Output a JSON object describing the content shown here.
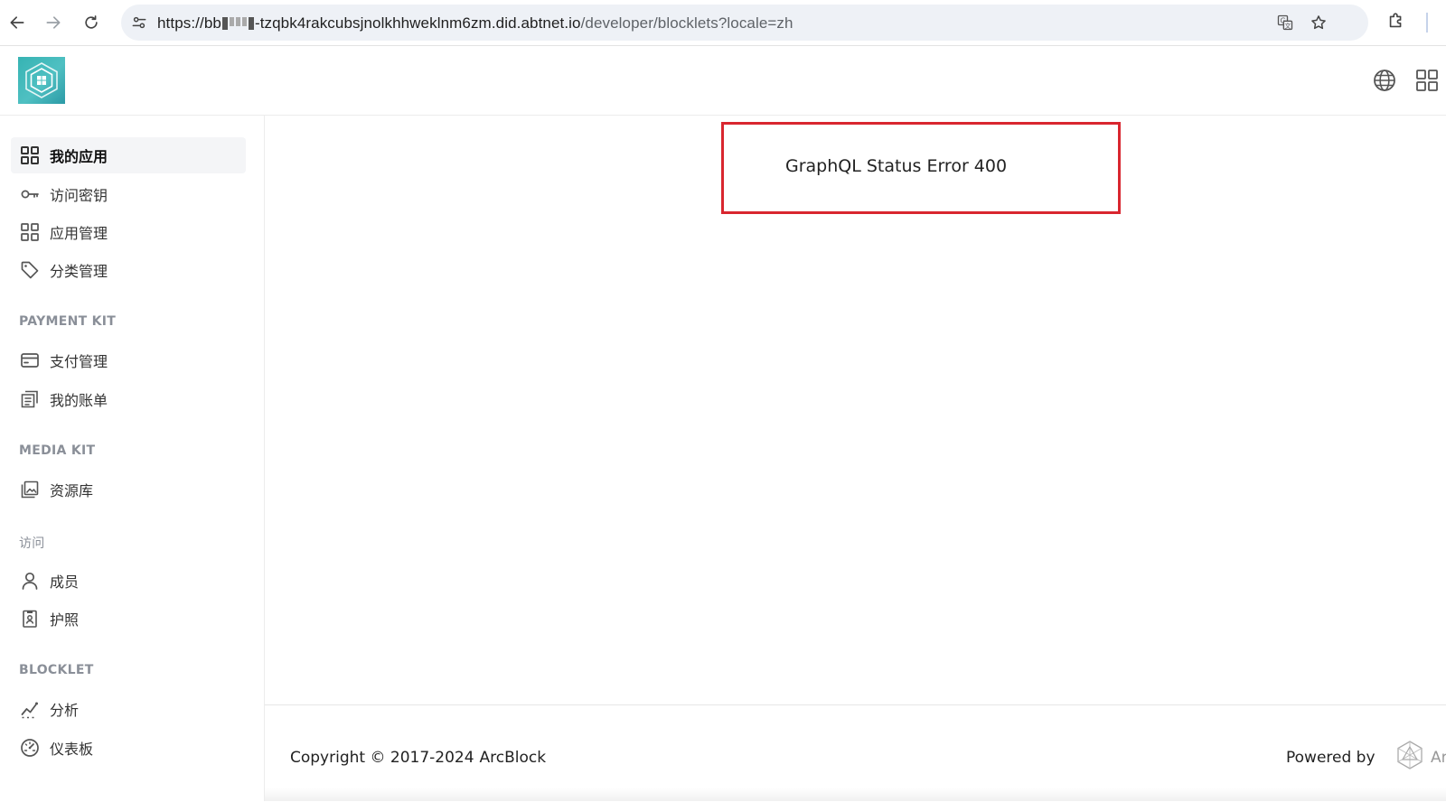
{
  "browser": {
    "url_prefix": "https://bb",
    "url_host_visible": "-tzqbk4rakcubsjnolkhhweklnm6zm.did.abtnet.io",
    "url_path": "/developer/blocklets?locale=zh"
  },
  "icons": {
    "back": "arrow-left-icon",
    "forward": "arrow-right-icon",
    "reload": "reload-icon",
    "site_info": "tune-icon",
    "translate": "translate-icon",
    "bookmark": "star-icon",
    "extensions": "puzzle-icon",
    "language": "globe-icon",
    "apps": "grid-icon"
  },
  "sidebar": {
    "groups": [
      {
        "items": [
          {
            "label": "我的应用",
            "icon": "grid-icon",
            "active": true
          },
          {
            "label": "访问密钥",
            "icon": "key-icon"
          },
          {
            "label": "应用管理",
            "icon": "grid-icon"
          },
          {
            "label": "分类管理",
            "icon": "tag-icon"
          }
        ]
      },
      {
        "title": "PAYMENT KIT",
        "items": [
          {
            "label": "支付管理",
            "icon": "credit-card-icon"
          },
          {
            "label": "我的账单",
            "icon": "receipt-icon"
          }
        ]
      },
      {
        "title": "MEDIA KIT",
        "items": [
          {
            "label": "资源库",
            "icon": "image-library-icon"
          }
        ]
      },
      {
        "title": "访问",
        "items": [
          {
            "label": "成员",
            "icon": "user-icon"
          },
          {
            "label": "护照",
            "icon": "passport-icon"
          }
        ]
      },
      {
        "title": "BLOCKLET",
        "items": [
          {
            "label": "分析",
            "icon": "analytics-icon"
          },
          {
            "label": "仪表板",
            "icon": "dashboard-gauge-icon"
          }
        ]
      }
    ]
  },
  "main": {
    "error_message": "GraphQL Status Error 400",
    "highlight_color": "#d9262f"
  },
  "footer": {
    "copyright": "Copyright © 2017-2024",
    "brand": "ArcBlock",
    "powered_by": "Powered by",
    "powered_brand_partial": "Ar"
  },
  "colors": {
    "logo_teal": "#36b3b3",
    "active_bg": "#f4f5f7",
    "omnibox_bg": "#eef1f6"
  }
}
